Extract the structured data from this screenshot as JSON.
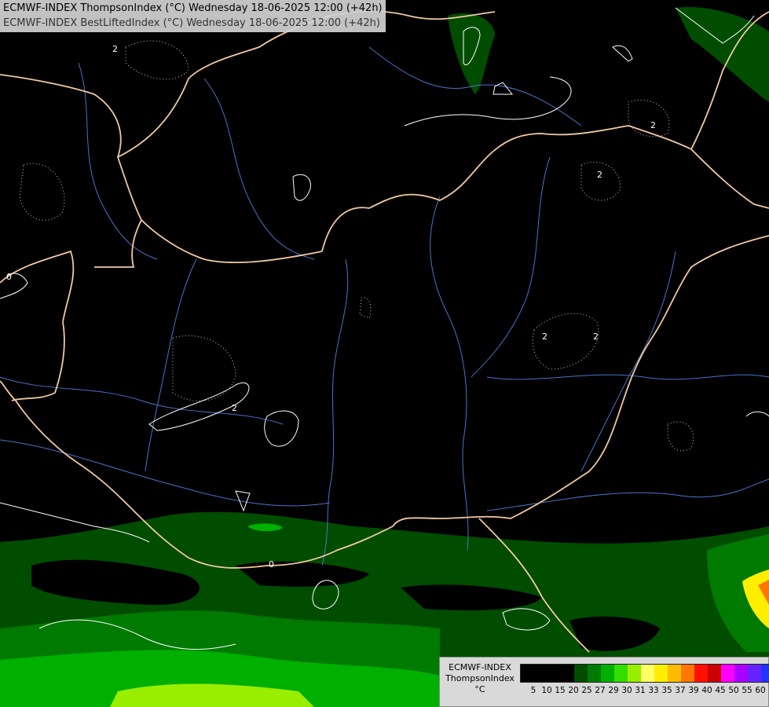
{
  "header": {
    "line1": "ECMWF-INDEX ThompsonIndex (°C) Wednesday 18-06-2025 12:00 (+42h)",
    "line2": "ECMWF-INDEX BestLiftedIndex (°C) Wednesday 18-06-2025 12:00 (+42h)"
  },
  "map": {
    "contour_labels": [
      "2",
      "2",
      "0",
      "2",
      "2",
      "2",
      "2",
      "0"
    ],
    "colors": {
      "background": "#000000",
      "borders": "#f2c9a0",
      "rivers": "#4a72c8",
      "contours": "#ffffff"
    }
  },
  "legend": {
    "label_lines": [
      "ECMWF-INDEX",
      "ThompsonIndex",
      "°C"
    ],
    "ticks": [
      "5",
      "10",
      "15",
      "20",
      "25",
      "27",
      "29",
      "30",
      "31",
      "33",
      "35",
      "37",
      "39",
      "40",
      "45",
      "50",
      "55",
      "60"
    ],
    "colors": [
      "#000000",
      "#000000",
      "#000000",
      "#000000",
      "#004d00",
      "#007a00",
      "#00b000",
      "#33dd00",
      "#99ee00",
      "#ffff66",
      "#ffee00",
      "#ffbb00",
      "#ff7700",
      "#ff1100",
      "#cc0000",
      "#ff00ff",
      "#aa00ff",
      "#6622ff",
      "#2233ff"
    ]
  }
}
